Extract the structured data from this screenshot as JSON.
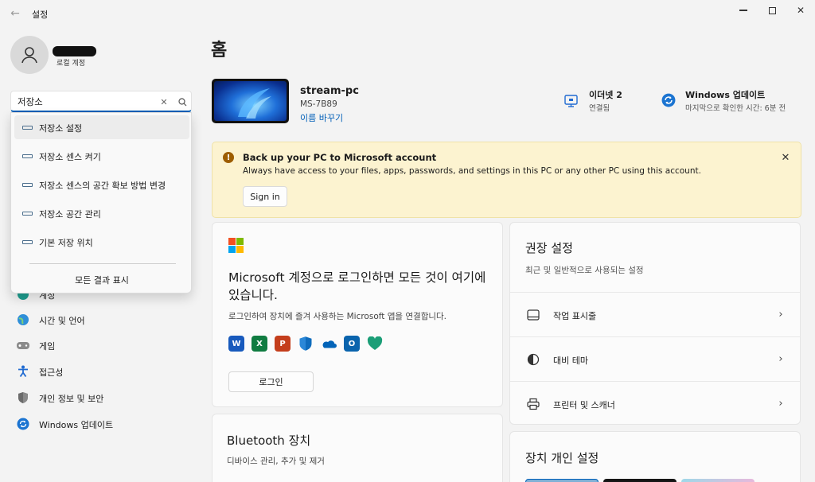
{
  "window": {
    "app_title": "설정",
    "back_glyph": "←",
    "minimize_label": "",
    "maximize_label": "",
    "close_glyph": "✕"
  },
  "profile": {
    "account_type": "로컬 계정"
  },
  "search": {
    "value": "저장소",
    "placeholder": "",
    "clear_glyph": "✕",
    "suggestions": [
      {
        "label": "저장소 설정"
      },
      {
        "label": "저장소 센스 켜기"
      },
      {
        "label": "저장소 센스의 공간 확보 방법 변경"
      },
      {
        "label": "저장소 공간 관리"
      },
      {
        "label": "기본 저장 위치"
      }
    ],
    "show_all": "모든 결과 표시"
  },
  "nav": {
    "items": [
      {
        "label": "계정",
        "icon": "account-icon"
      },
      {
        "label": "시간 및 언어",
        "icon": "globe-icon"
      },
      {
        "label": "게임",
        "icon": "gamepad-icon"
      },
      {
        "label": "접근성",
        "icon": "accessibility-icon"
      },
      {
        "label": "개인 정보 및 보안",
        "icon": "shield-icon"
      },
      {
        "label": "Windows 업데이트",
        "icon": "update-icon"
      }
    ]
  },
  "main": {
    "title": "홈",
    "device": {
      "name": "stream-pc",
      "model": "MS-7B89",
      "rename": "이름 바꾸기"
    },
    "network": {
      "title": "이더넷 2",
      "status": "연결됨"
    },
    "update": {
      "title": "Windows 업데이트",
      "status": "마지막으로 확인한 시간: 6분 전"
    },
    "banner": {
      "title": "Back up your PC to Microsoft account",
      "text": "Always have access to your files, apps, passwords, and settings in this PC or any other PC using this account.",
      "button": "Sign in",
      "icon_glyph": "!",
      "close_glyph": "✕"
    },
    "ms_card": {
      "title": "Microsoft 계정으로 로그인하면 모든 것이 여기에 있습니다.",
      "description": "로그인하여 장치에 즐겨 사용하는 Microsoft 앱을 연결합니다.",
      "button": "로그인",
      "apps": [
        {
          "name": "word-icon",
          "glyph": "W",
          "color": "#185abd"
        },
        {
          "name": "excel-icon",
          "glyph": "X",
          "color": "#107c41"
        },
        {
          "name": "powerpoint-icon",
          "glyph": "P",
          "color": "#c43e1c"
        },
        {
          "name": "defender-icon",
          "glyph": "",
          "color": "#0f6cbd"
        },
        {
          "name": "onedrive-icon",
          "glyph": "",
          "color": "#0364b8"
        },
        {
          "name": "outlook-icon",
          "glyph": "O",
          "color": "#0a64ad"
        },
        {
          "name": "family-icon",
          "glyph": "",
          "color": "#1b9e77"
        }
      ]
    },
    "bluetooth_card": {
      "title": "Bluetooth 장치",
      "subtitle": "디바이스 관리, 추가 및 제거"
    },
    "recommended": {
      "title": "권장 설정",
      "subtitle": "최근 및 일반적으로 사용되는 설정",
      "items": [
        {
          "label": "작업 표시줄",
          "icon": "taskbar-icon"
        },
        {
          "label": "대비 테마",
          "icon": "contrast-icon"
        },
        {
          "label": "프린터 및 스캐너",
          "icon": "printer-icon"
        }
      ],
      "chevron_glyph": "›"
    },
    "personalize": {
      "title": "장치 개인 설정"
    }
  },
  "colors": {
    "accent": "#005fb8",
    "banner_bg": "#fcf3d0",
    "warning": "#9d5d00"
  }
}
